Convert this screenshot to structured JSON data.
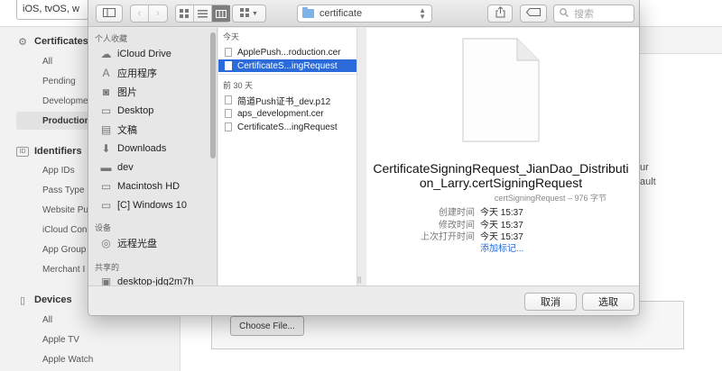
{
  "background": {
    "platform_select": "iOS, tvOS, w",
    "sections": [
      {
        "icon": "certificate-icon",
        "label": "Certificates",
        "items": [
          "All",
          "Pending",
          "Developme",
          "Production"
        ]
      },
      {
        "icon": "id-icon",
        "label": "Identifiers",
        "items": [
          "App IDs",
          "Pass Type",
          "Website Pu",
          "iCloud Con",
          "App Group",
          "Merchant I"
        ]
      },
      {
        "icon": "device-icon",
        "label": "Devices",
        "items": [
          "All",
          "Apple TV",
          "Apple Watch"
        ]
      }
    ],
    "active_item": "Production",
    "right_fragments": {
      "line1": "ur",
      "line2": "ault"
    },
    "choose_file_label": "Choose File..."
  },
  "dialog": {
    "toolbar": {
      "location": "certificate",
      "search_placeholder": "搜索"
    },
    "sidebar": {
      "favorites_header": "个人收藏",
      "favorites": [
        {
          "icon": "cloud-icon",
          "label": "iCloud Drive"
        },
        {
          "icon": "apps-icon",
          "label": "应用程序"
        },
        {
          "icon": "camera-icon",
          "label": "图片"
        },
        {
          "icon": "desktop-icon",
          "label": "Desktop"
        },
        {
          "icon": "document-icon",
          "label": "文稿"
        },
        {
          "icon": "downloads-icon",
          "label": "Downloads"
        },
        {
          "icon": "folder-icon",
          "label": "dev"
        },
        {
          "icon": "harddisk-icon",
          "label": "Macintosh HD"
        },
        {
          "icon": "harddisk-icon",
          "label": "[C] Windows 10"
        }
      ],
      "devices_header": "设备",
      "devices": [
        {
          "icon": "disc-icon",
          "label": "远程光盘"
        }
      ],
      "shared_header": "共享的",
      "shared": [
        {
          "icon": "computer-icon",
          "label": "desktop-jdg2m7h"
        }
      ]
    },
    "browser": {
      "today_header": "今天",
      "today_files": [
        "ApplePush...roduction.cer",
        "CertificateS...ingRequest"
      ],
      "selected_index": 1,
      "earlier_header": "前 30 天",
      "earlier_files": [
        "简道Push证书_dev.p12",
        "aps_development.cer",
        "CertificateS...ingRequest"
      ]
    },
    "preview": {
      "filename": "CertificateSigningRequest_JianDao_Distribution_Larry.certSigningRequest",
      "kind": "certSigningRequest – 976 字节",
      "meta": [
        {
          "label": "创建时间",
          "value": "今天 15:37"
        },
        {
          "label": "修改时间",
          "value": "今天 15:37"
        },
        {
          "label": "上次打开时间",
          "value": "今天 15:37"
        }
      ],
      "add_tags": "添加标记..."
    },
    "footer": {
      "cancel": "取消",
      "choose": "选取"
    }
  }
}
